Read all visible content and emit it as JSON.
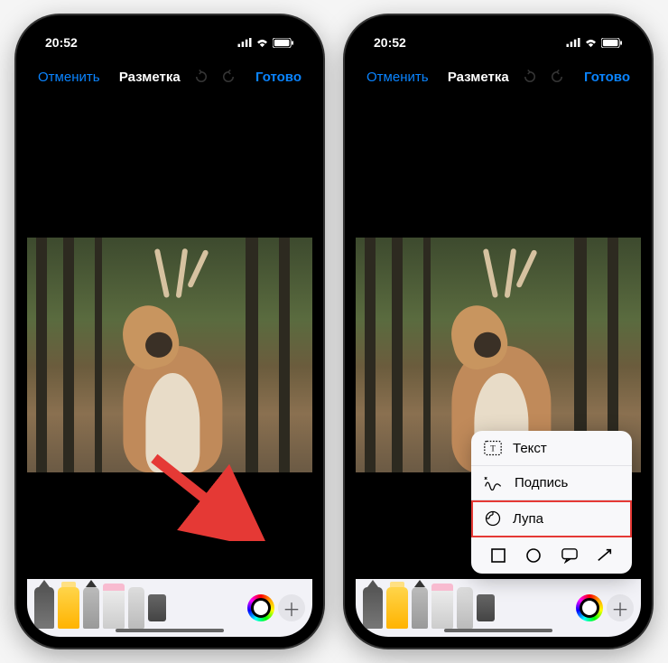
{
  "statusbar": {
    "time": "20:52"
  },
  "navbar": {
    "cancel": "Отменить",
    "title": "Разметка",
    "done": "Готово"
  },
  "popup": {
    "text": "Текст",
    "signature": "Подпись",
    "magnifier": "Лупа"
  },
  "colors": {
    "accent": "#0a84ff",
    "highlight": "#e53935"
  }
}
